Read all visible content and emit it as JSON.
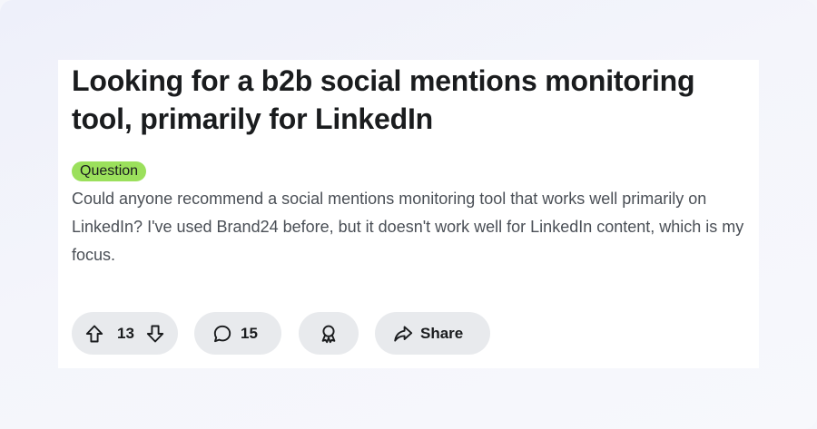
{
  "post": {
    "title": "Looking for a b2b social mentions monitoring tool, primarily for LinkedIn",
    "flair": "Question",
    "body": "Could anyone recommend a social mentions monitoring tool that works well primarily on LinkedIn? I've used Brand24 before, but it doesn't work well for LinkedIn content, which is my focus."
  },
  "actions": {
    "upvote_icon": "upvote-arrow-icon",
    "downvote_icon": "downvote-arrow-icon",
    "vote_count": "13",
    "comment_icon": "comment-bubble-icon",
    "comment_count": "15",
    "award_icon": "award-icon",
    "share_icon": "share-arrow-icon",
    "share_label": "Share"
  },
  "colors": {
    "flair_background": "#9be05c",
    "action_pill_background": "#e8eaed",
    "title_text": "#1a1c1e",
    "body_text": "#4a4f56",
    "page_background": "#f5f6fb"
  }
}
